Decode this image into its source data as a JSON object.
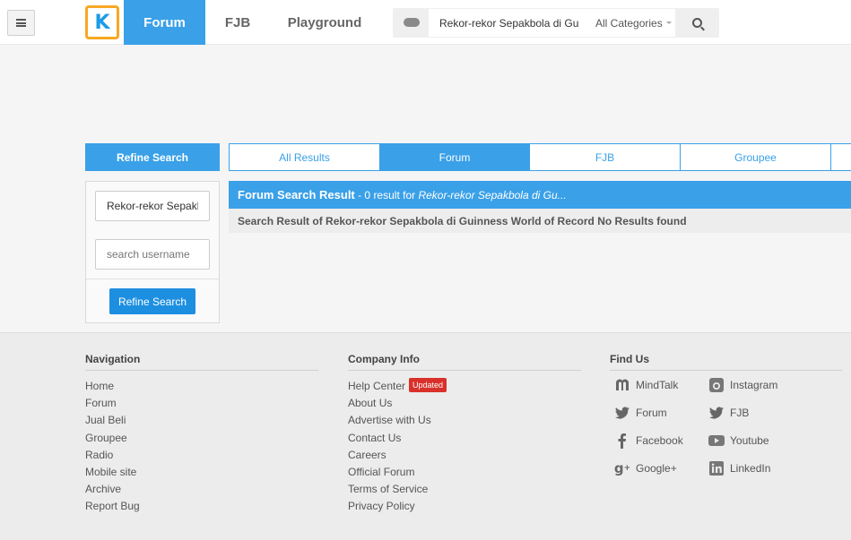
{
  "header": {
    "logo_letter": "K",
    "tabs": [
      "Forum",
      "FJB",
      "Playground"
    ],
    "search": {
      "value": "Rekor-rekor Sepakbola di Gu",
      "category": "All Categories"
    }
  },
  "refine": {
    "title": "Refine Search",
    "keyword_value": "Rekor-rekor Sepakbola di Guinness World of Record",
    "username_placeholder": "search username",
    "button": "Refine Search"
  },
  "result_tabs": [
    "All Results",
    "Forum",
    "FJB",
    "Groupee"
  ],
  "results": {
    "title": "Forum Search Result",
    "count_text": " - 0 result for ",
    "query": "Rekor-rekor Sepakbola di Gu...",
    "message": "Search Result of Rekor-rekor Sepakbola di Guinness World of Record No Results found"
  },
  "footer": {
    "navigation": {
      "title": "Navigation",
      "items": [
        "Home",
        "Forum",
        "Jual Beli",
        "Groupee",
        "Radio",
        "Mobile site",
        "Archive",
        "Report Bug"
      ]
    },
    "company": {
      "title": "Company Info",
      "items": [
        "Help Center",
        "About Us",
        "Advertise with Us",
        "Contact Us",
        "Careers",
        "Official Forum",
        "Terms of Service",
        "Privacy Policy"
      ],
      "badge": "Updated"
    },
    "find_us": {
      "title": "Find Us",
      "links": [
        {
          "label": "MindTalk",
          "icon": "mindtalk-icon"
        },
        {
          "label": "Instagram",
          "icon": "instagram-icon"
        },
        {
          "label": "Forum",
          "icon": "twitter-icon"
        },
        {
          "label": "FJB",
          "icon": "twitter-icon"
        },
        {
          "label": "Facebook",
          "icon": "facebook-icon"
        },
        {
          "label": "Youtube",
          "icon": "youtube-icon"
        },
        {
          "label": "Google+",
          "icon": "googleplus-icon"
        },
        {
          "label": "LinkedIn",
          "icon": "linkedin-icon"
        }
      ]
    }
  },
  "colors": {
    "accent": "#3aa0e8",
    "logo_border": "#f7a823",
    "badge": "#d9302b"
  }
}
